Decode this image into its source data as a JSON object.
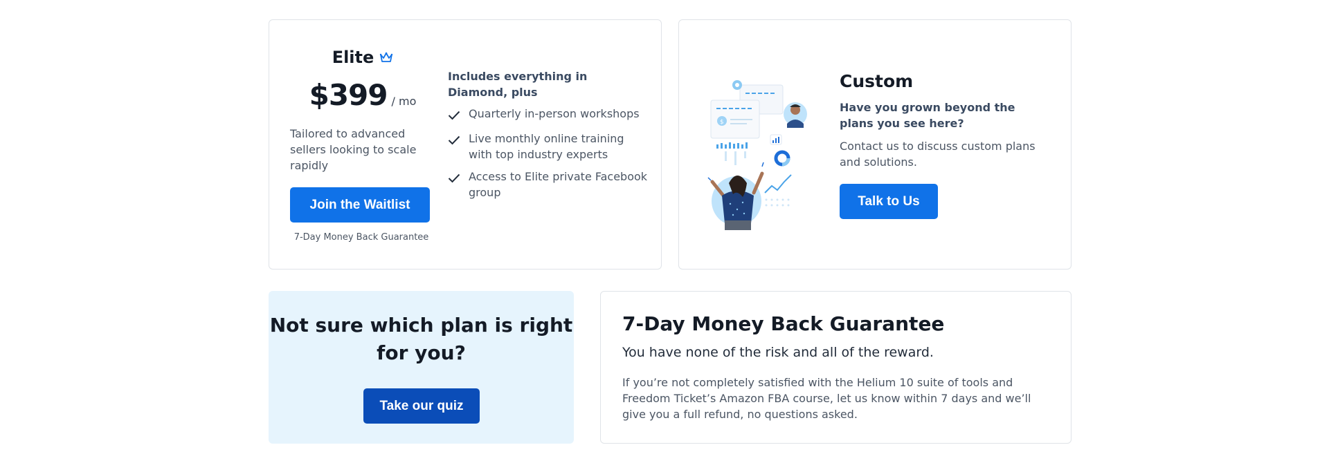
{
  "elite": {
    "title": "Elite",
    "price": "$399",
    "period": "/ mo",
    "description": "Tailored to advanced sellers looking to scale rapidly",
    "button_label": "Join the Waitlist",
    "guarantee": "7-Day Money Back Guarantee",
    "includes_heading": "Includes everything in Diamond, plus",
    "features": [
      "Quarterly in-person workshops",
      "Live monthly online training with top industry experts",
      "Access to Elite private Facebook group"
    ],
    "icon": "crown-icon"
  },
  "custom": {
    "title": "Custom",
    "subtitle": "Have you grown beyond the plans you see here?",
    "description": "Contact us to discuss custom plans and solutions.",
    "button_label": "Talk to Us"
  },
  "quiz": {
    "title": "Not sure which plan is right for you?",
    "button_label": "Take our quiz"
  },
  "money_back": {
    "title": "7-Day Money Back Guarantee",
    "subtitle": "You have none of the risk and all of the reward.",
    "description": "If you’re not completely satisfied with the Helium 10 suite of tools and Freedom Ticket’s Amazon FBA course, let us know within 7 days and we’ll give you a full refund, no questions asked."
  },
  "colors": {
    "primary_button": "#1072e8",
    "quiz_button": "#0b4db8",
    "quiz_background": "#e6f4fd",
    "card_border": "#dfe3e8"
  }
}
